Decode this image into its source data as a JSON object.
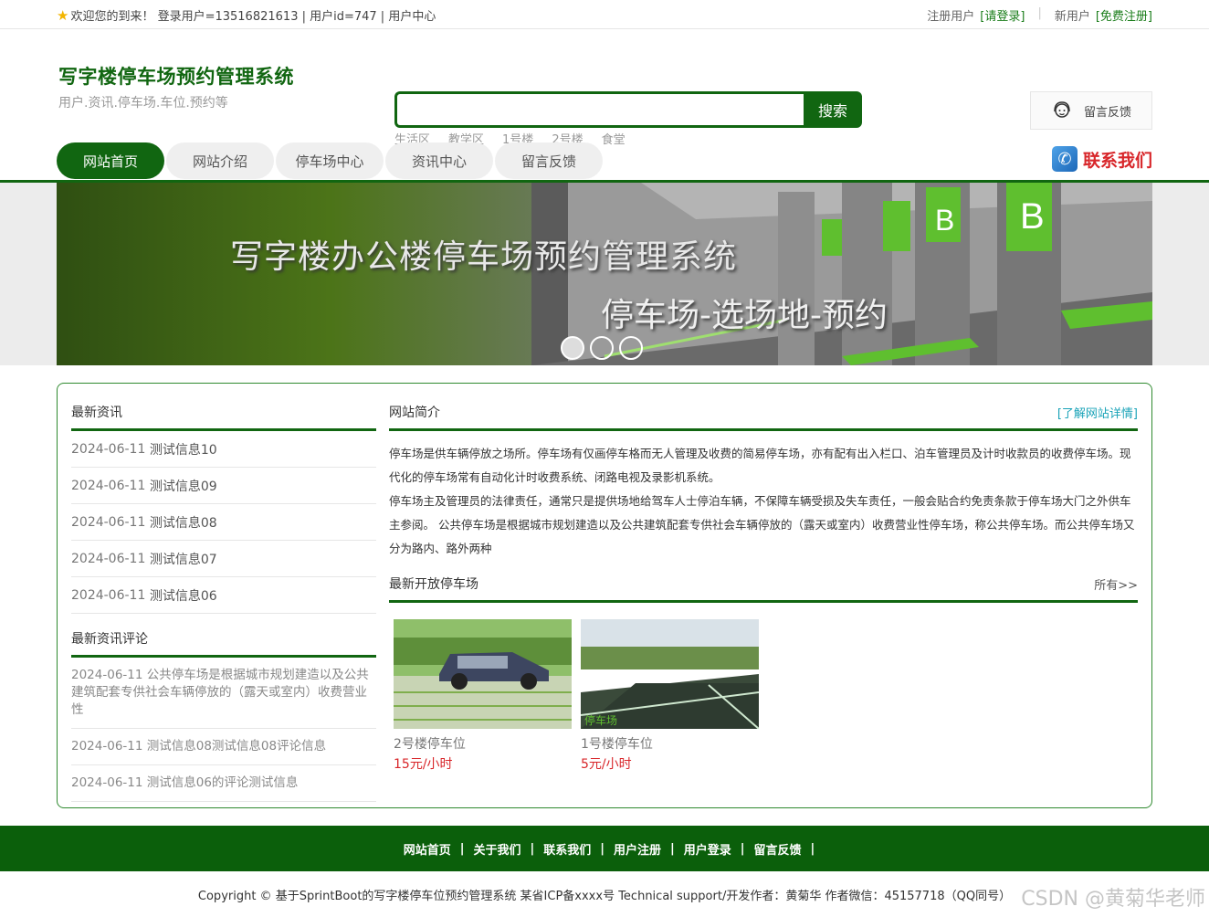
{
  "topbar": {
    "welcome": "欢迎您的到来！ 登录用户=13516821613 | 用户id=747 | 用户中心",
    "registered_prefix": "注册用户",
    "login_link": "[请登录]",
    "new_prefix": "新用户",
    "register_link": "[免费注册]"
  },
  "header": {
    "site_title": "写字楼停车场预约管理系统",
    "site_subtitle": "用户.资讯.停车场.车位.预约等",
    "search_button": "搜索",
    "search_value": "",
    "hotwords": [
      "生活区",
      "教学区",
      "1号楼",
      "2号楼",
      "食堂"
    ],
    "feedback_label": "留言反馈"
  },
  "nav": {
    "items": [
      "网站首页",
      "网站介绍",
      "停车场中心",
      "资讯中心",
      "留言反馈"
    ],
    "active_index": 0,
    "contact_label": "联系我们"
  },
  "banner": {
    "headline": "写字楼办公楼停车场预约管理系统",
    "subline": "停车场-选场地-预约",
    "slides": 3,
    "current_slide": 1
  },
  "news": {
    "title": "最新资讯",
    "items": [
      {
        "date": "2024-06-11",
        "title": "测试信息10"
      },
      {
        "date": "2024-06-11",
        "title": "测试信息09"
      },
      {
        "date": "2024-06-11",
        "title": "测试信息08"
      },
      {
        "date": "2024-06-11",
        "title": "测试信息07"
      },
      {
        "date": "2024-06-11",
        "title": "测试信息06"
      }
    ]
  },
  "comments": {
    "title": "最新资讯评论",
    "items": [
      "2024-06-11 公共停车场是根据城市规划建造以及公共建筑配套专供社会车辆停放的（露天或室内）收费营业性",
      "2024-06-11 测试信息08测试信息08评论信息",
      "2024-06-11 测试信息06的评论测试信息"
    ]
  },
  "intro": {
    "title": "网站简介",
    "more": "[了解网站详情]",
    "paragraph1": "停车场是供车辆停放之场所。停车场有仅画停车格而无人管理及收费的简易停车场，亦有配有出入栏口、泊车管理员及计时收款员的收费停车场。现代化的停车场常有自动化计时收费系统、闭路电视及录影机系统。",
    "paragraph2": "停车场主及管理员的法律责任，通常只是提供场地给驾车人士停泊车辆，不保障车辆受损及失车责任，一般会贴合约免责条款于停车场大门之外供车主参阅。 公共停车场是根据城市规划建造以及公共建筑配套专供社会车辆停放的（露天或室内）收费营业性停车场，称公共停车场。而公共停车场又分为路内、路外两种"
  },
  "lots": {
    "title": "最新开放停车场",
    "more": "所有>>",
    "items": [
      {
        "name": "2号楼停车位",
        "price": "15元/小时"
      },
      {
        "name": "1号楼停车位",
        "price": "5元/小时",
        "image_caption": "停车场"
      }
    ]
  },
  "footer": {
    "links": [
      "网站首页",
      "关于我们",
      "联系我们",
      "用户注册",
      "用户登录",
      "留言反馈"
    ],
    "copyright": "Copyright © 基于SprintBoot的写字楼停车位预约管理系统    某省ICP备xxxx号    Technical support/开发作者：黄菊华    作者微信：45157718（QQ同号）",
    "watermark": "CSDN @黄菊华老师"
  }
}
